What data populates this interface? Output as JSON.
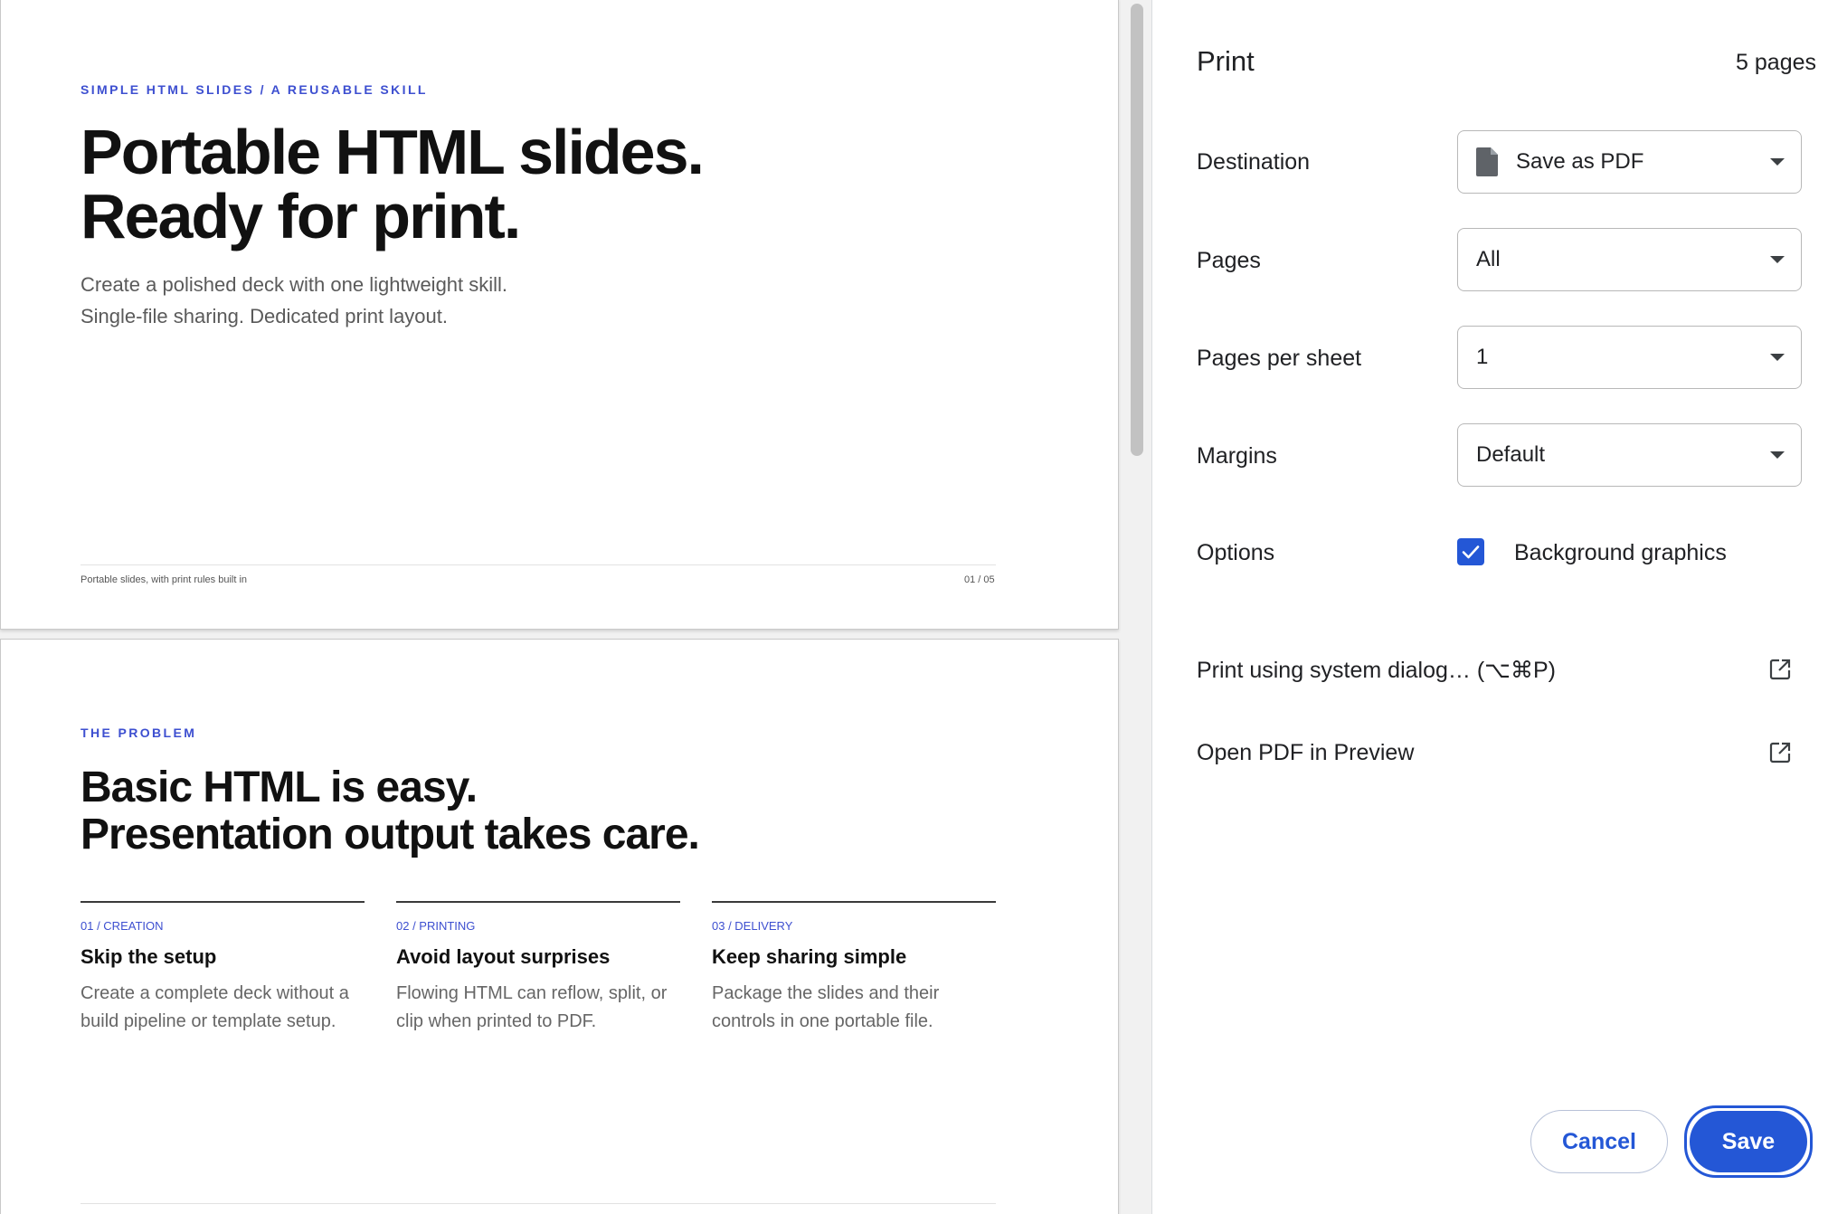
{
  "slides": [
    {
      "kicker": "SIMPLE HTML SLIDES / A REUSABLE SKILL",
      "title_line1": "Portable HTML slides.",
      "title_line2": "Ready for print.",
      "subtitle_line1": "Create a polished deck with one lightweight skill.",
      "subtitle_line2": "Single-file sharing. Dedicated print layout.",
      "footer_left": "Portable slides, with print rules built in",
      "footer_right": "01 / 05"
    },
    {
      "kicker": "THE PROBLEM",
      "title_line1": "Basic HTML is easy.",
      "title_line2": "Presentation output takes care.",
      "columns": [
        {
          "kicker": "01 / CREATION",
          "title": "Skip the setup",
          "body": "Create a complete deck without a build pipeline or template setup."
        },
        {
          "kicker": "02 / PRINTING",
          "title": "Avoid layout surprises",
          "body": "Flowing HTML can reflow, split, or clip when printed to PDF."
        },
        {
          "kicker": "03 / DELIVERY",
          "title": "Keep sharing simple",
          "body": "Package the slides and their controls in one portable file."
        }
      ]
    }
  ],
  "print_panel": {
    "title": "Print",
    "page_count": "5 pages",
    "destination_label": "Destination",
    "destination_value": "Save as PDF",
    "destination_icon": "document-icon",
    "pages_label": "Pages",
    "pages_value": "All",
    "pages_per_sheet_label": "Pages per sheet",
    "pages_per_sheet_value": "1",
    "margins_label": "Margins",
    "margins_value": "Default",
    "options_label": "Options",
    "background_graphics_label": "Background graphics",
    "background_graphics_checked": true,
    "system_dialog_label": "Print using system dialog… (⌥⌘P)",
    "open_preview_label": "Open PDF in Preview",
    "external_icon": "open-external-icon",
    "cancel_label": "Cancel",
    "save_label": "Save"
  },
  "colors": {
    "accent": "#2457d6",
    "slide_kicker": "#3d4fd0",
    "slide_title": "#111111"
  }
}
